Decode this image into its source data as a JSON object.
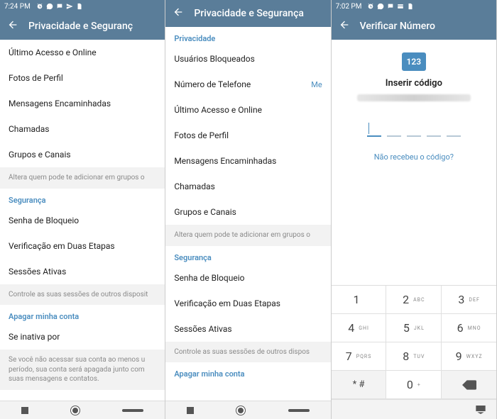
{
  "phone1": {
    "status_time": "7:24 PM",
    "title": "Privacidade e Seguranç",
    "privacy_items": [
      "Último Acesso e Online",
      "Fotos de Perfil",
      "Mensagens Encaminhadas",
      "Chamadas",
      "Grupos e Canais"
    ],
    "privacy_hint": "Altera quem pode te adicionar em grupos o",
    "section_security": "Segurança",
    "security_items": [
      "Senha de Bloqueio",
      "Verificação em Duas Etapas",
      "Sessões Ativas"
    ],
    "security_hint": "Controle as suas sessões de outros disposit",
    "section_delete": "Apagar minha conta",
    "delete_item": "Se inativa por",
    "delete_hint": "Se você não acessar sua conta ao menos u período, sua conta será apagada junto com suas mensagens e contatos."
  },
  "phone2": {
    "title": "Privacidade e Segurança",
    "section_privacy": "Privacidade",
    "privacy_items": [
      {
        "label": "Usuários Bloqueados",
        "value": ""
      },
      {
        "label": "Número de Telefone",
        "value": "Me"
      },
      {
        "label": "Último Acesso e Online",
        "value": ""
      },
      {
        "label": "Fotos de Perfil",
        "value": ""
      },
      {
        "label": "Mensagens Encaminhadas",
        "value": ""
      },
      {
        "label": "Chamadas",
        "value": ""
      },
      {
        "label": "Grupos e Canais",
        "value": ""
      }
    ],
    "privacy_hint": "Altera quem pode te adicionar em grupos o",
    "section_security": "Segurança",
    "security_items": [
      "Senha de Bloqueio",
      "Verificação em Duas Etapas",
      "Sessões Ativas"
    ],
    "security_hint": "Controle as suas sessões de outros dispos",
    "section_delete": "Apagar minha conta"
  },
  "phone3": {
    "status_time": "7:02 PM",
    "title": "Verificar Número",
    "chat_icon_text": "123",
    "insert_label": "Inserir código",
    "resend_label": "Não recebeu o código?",
    "keypad": {
      "rows": [
        [
          {
            "n": "1",
            "l": ""
          },
          {
            "n": "2",
            "l": "ABC"
          },
          {
            "n": "3",
            "l": "DEF"
          }
        ],
        [
          {
            "n": "4",
            "l": "GHI"
          },
          {
            "n": "5",
            "l": "JKL"
          },
          {
            "n": "6",
            "l": "MNO"
          }
        ],
        [
          {
            "n": "7",
            "l": "PQRS"
          },
          {
            "n": "8",
            "l": "TUV"
          },
          {
            "n": "9",
            "l": "WXYZ"
          }
        ]
      ],
      "star_hash": "* #",
      "zero": {
        "n": "0",
        "l": "+"
      }
    }
  }
}
